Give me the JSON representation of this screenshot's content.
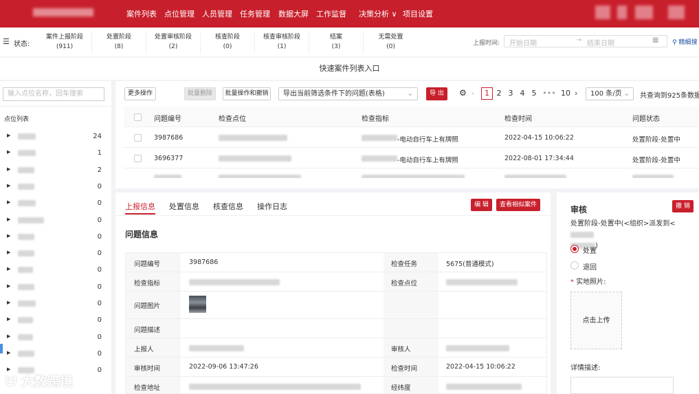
{
  "nav": [
    "案件列表",
    "点位管理",
    "人员管理",
    "任务管理",
    "数据大屏",
    "工作监督",
    "决策分析",
    "项目设置"
  ],
  "status": {
    "label": "状态:",
    "stages": [
      {
        "name": "案件上报阶段",
        "count": "(911)"
      },
      {
        "name": "处置阶段",
        "count": "(8)"
      },
      {
        "name": "处置审核阶段",
        "count": "(2)"
      },
      {
        "name": "核查阶段",
        "count": "(0)"
      },
      {
        "name": "核查审核阶段",
        "count": "(1)"
      },
      {
        "name": "结案",
        "count": "(3)"
      },
      {
        "name": "无需处置",
        "count": "(0)"
      }
    ],
    "report_time_label": "上报时间:",
    "start_placeholder": "开始日期",
    "end_placeholder": "结束日期",
    "advanced_search": "精细搜"
  },
  "quick_entry": "快速案件列表入口",
  "left": {
    "search_placeholder": "输入点位名称，回车搜索",
    "title": "点位列表",
    "counts": [
      "24",
      "1",
      "2",
      "0",
      "0",
      "0",
      "0",
      "0",
      "0",
      "0",
      "0",
      "0",
      "0",
      "0",
      "0"
    ]
  },
  "toolbar": {
    "more_ops": "更多操作",
    "batch_delete": "批量删除",
    "batch_revoke": "批量操作和撤销",
    "export_select": "导出当前筛选条件下的问题(表格)",
    "export_btn": "导 出",
    "pages": [
      "1",
      "2",
      "3",
      "4",
      "5",
      "•••",
      "10"
    ],
    "page_size": "100 条/页",
    "total": "共查询到925条数据"
  },
  "table": {
    "headers": [
      "问题编号",
      "检查点位",
      "检查指标",
      "检查时间",
      "问题状态"
    ],
    "rows": [
      {
        "id": "3987686",
        "metric": "-电动自行车上有牌照",
        "time": "2022-04-15 10:06:22",
        "status": "处置阶段-处置中"
      },
      {
        "id": "3696377",
        "metric": "-电动自行车上有牌照",
        "time": "2022-08-01 17:34:44",
        "status": "处置阶段-处置中"
      }
    ]
  },
  "detail": {
    "tabs": [
      "上报信息",
      "处置信息",
      "核查信息",
      "操作日志"
    ],
    "edit_btn": "编 辑",
    "similar_btn": "查看相似案件",
    "section_title": "问题信息",
    "fields": {
      "problem_id_label": "问题编号",
      "problem_id": "3987686",
      "task_label": "检查任务",
      "task": "5675(普通模式)",
      "metric_label": "检查指标",
      "point_label": "检查点位",
      "image_label": "问题图片",
      "desc_label": "问题描述",
      "reporter_label": "上报人",
      "auditor_label": "审核人",
      "audit_time_label": "审核时间",
      "audit_time": "2022-09-06 13:47:26",
      "check_time_label": "检查时间",
      "check_time": "2022-04-15 10:06:22",
      "address_label": "检查地址",
      "lnglat_label": "经纬度"
    }
  },
  "review": {
    "title": "审核",
    "revoke_btn": "撤 销",
    "state": "处置阶段-处置中(<组织>派发到<",
    "state_end": ")",
    "opt_handle": "处置",
    "opt_return": "退回",
    "photo_label": "实地照片:",
    "upload": "点击上传",
    "detail_label": "详情描述:"
  },
  "watermark": "大数跨境",
  "colors": {
    "brand": "#c81f2c"
  }
}
